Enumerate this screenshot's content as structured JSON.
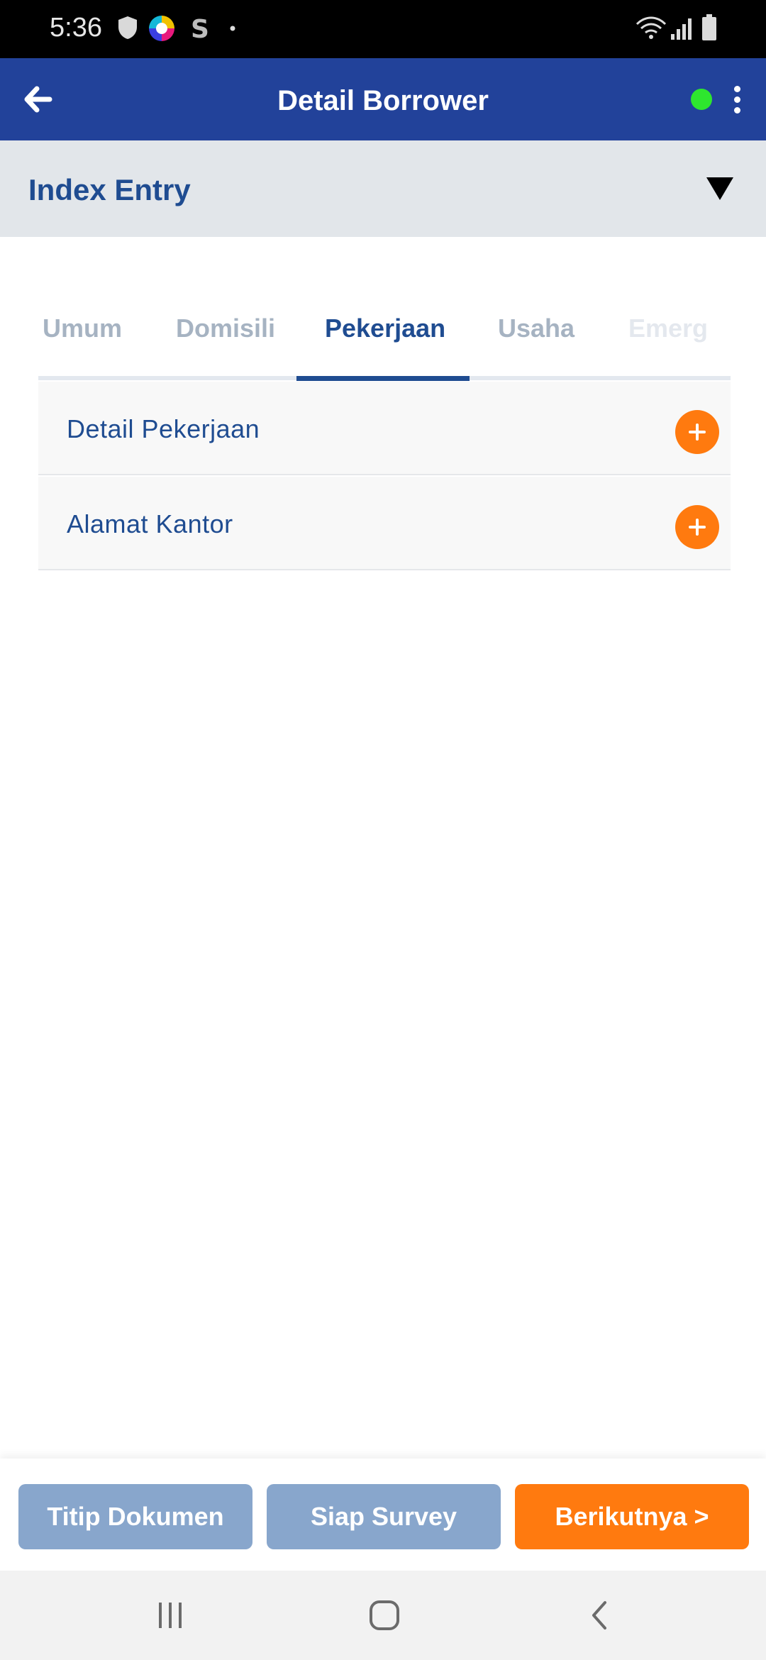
{
  "status_bar": {
    "time": "5:36",
    "icons": [
      "shield-icon",
      "colorful-app-icon",
      "s-app-icon",
      "dot-icon",
      "wifi-icon",
      "signal-icon",
      "battery-icon"
    ]
  },
  "app_bar": {
    "title": "Detail Borrower",
    "back_icon": "arrow-left-icon",
    "status_dot_color": "#2ee62e",
    "menu_icon": "more-vertical-icon"
  },
  "index_entry": {
    "label": "Index Entry",
    "caret_icon": "caret-down-icon"
  },
  "tabs": [
    {
      "label": "Umum",
      "active": false
    },
    {
      "label": "Domisili",
      "active": false
    },
    {
      "label": "Pekerjaan",
      "active": true
    },
    {
      "label": "Usaha",
      "active": false
    },
    {
      "label": "Emerg",
      "active": false
    }
  ],
  "sections": [
    {
      "label": "Detail Pekerjaan",
      "icon": "plus-icon"
    },
    {
      "label": "Alamat Kantor",
      "icon": "plus-icon"
    }
  ],
  "actions": {
    "titip": "Titip Dokumen",
    "siap": "Siap Survey",
    "next": "Berikutnya >"
  },
  "nav_bar": {
    "recents_icon": "recents-icon",
    "home_icon": "home-icon",
    "back_icon": "back-chevron-icon"
  },
  "colors": {
    "primary": "#22429a",
    "accent": "#ff7a0f",
    "muted_button": "#88a6cc",
    "text_blue": "#1f4c91"
  }
}
